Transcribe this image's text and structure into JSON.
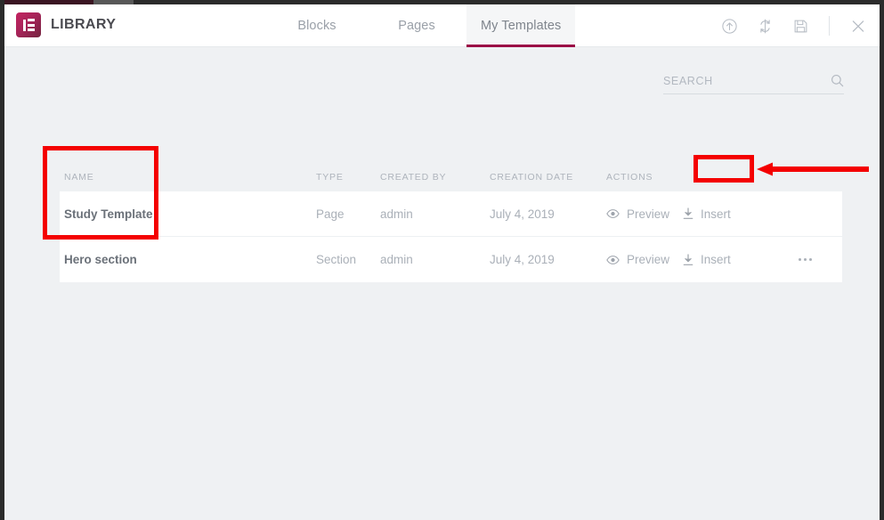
{
  "window": {
    "brand_title": "LIBRARY",
    "logo_icon": "elementor-logo-icon"
  },
  "header": {
    "tabs": [
      {
        "label": "Blocks",
        "active": false
      },
      {
        "label": "Pages",
        "active": false
      },
      {
        "label": "My Templates",
        "active": true
      }
    ],
    "actions": [
      {
        "name": "import-icon",
        "title": "Import Template"
      },
      {
        "name": "sync-icon",
        "title": "Sync Library"
      },
      {
        "name": "save-icon",
        "title": "Save"
      },
      {
        "name": "close-icon",
        "title": "Close"
      }
    ],
    "active_tab_color": "#9b0a46"
  },
  "search": {
    "placeholder": "SEARCH",
    "value": "",
    "icon": "search-icon"
  },
  "table": {
    "columns": [
      {
        "key": "name",
        "label": "NAME"
      },
      {
        "key": "type",
        "label": "TYPE"
      },
      {
        "key": "created_by",
        "label": "CREATED BY"
      },
      {
        "key": "creation_date",
        "label": "CREATION DATE"
      },
      {
        "key": "actions",
        "label": "ACTIONS"
      }
    ],
    "rows": [
      {
        "name": "Study Template",
        "type": "Page",
        "created_by": "admin",
        "creation_date": "July 4, 2019",
        "preview_label": "Preview",
        "insert_label": "Insert",
        "has_more_menu": false
      },
      {
        "name": "Hero section",
        "type": "Section",
        "created_by": "admin",
        "creation_date": "July 4, 2019",
        "preview_label": "Preview",
        "insert_label": "Insert",
        "has_more_menu": true
      }
    ]
  },
  "annotations": {
    "color": "#f40000",
    "name_column_box": "highlight around template name column",
    "insert_button_box": "highlight around Insert action of first row",
    "arrow": "red arrow pointing left toward Insert button"
  }
}
